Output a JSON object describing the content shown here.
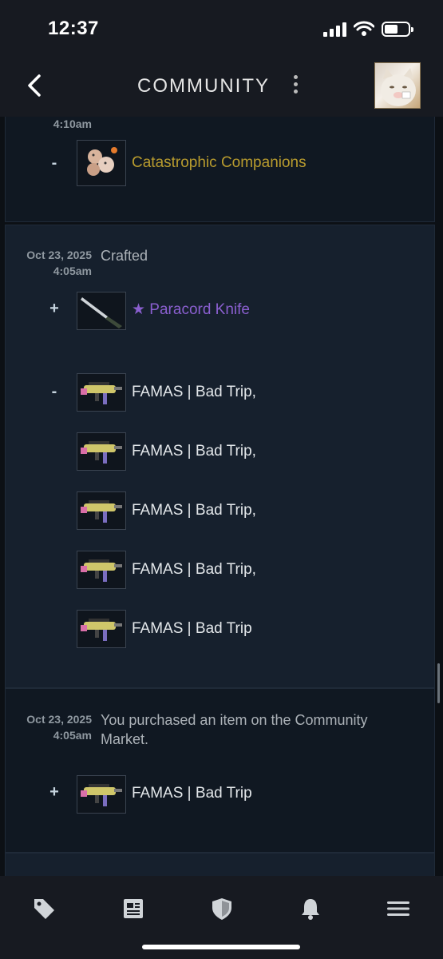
{
  "status_bar": {
    "time": "12:37"
  },
  "header": {
    "title": "COMMUNITY"
  },
  "entries": [
    {
      "date": "",
      "time": "4:10am",
      "description": "",
      "items": [
        {
          "sign": "-",
          "name": "Catastrophic Companions",
          "icon": "sticker-capsule-icon"
        }
      ]
    },
    {
      "date": "Oct 23, 2025",
      "time": "4:05am",
      "description": "Crafted",
      "items": [
        {
          "sign": "+",
          "name": "★ Paracord Knife",
          "icon": "knife-icon"
        },
        {
          "sign": "-",
          "name": "FAMAS | Bad Trip,",
          "icon": "famas-icon"
        },
        {
          "sign": "",
          "name": "FAMAS | Bad Trip,",
          "icon": "famas-icon"
        },
        {
          "sign": "",
          "name": "FAMAS | Bad Trip,",
          "icon": "famas-icon"
        },
        {
          "sign": "",
          "name": "FAMAS | Bad Trip,",
          "icon": "famas-icon"
        },
        {
          "sign": "",
          "name": "FAMAS | Bad Trip",
          "icon": "famas-icon"
        }
      ]
    },
    {
      "date": "Oct 23, 2025",
      "time": "4:05am",
      "description": "You purchased an item on the Community Market.",
      "items": [
        {
          "sign": "+",
          "name": "FAMAS | Bad Trip",
          "icon": "famas-icon"
        }
      ]
    }
  ],
  "bottom_nav": [
    {
      "label": "tag-icon"
    },
    {
      "label": "news-icon"
    },
    {
      "label": "shield-icon"
    },
    {
      "label": "bell-icon"
    },
    {
      "label": "menu-icon"
    }
  ],
  "colors": {
    "gold_item": "#b89b2e",
    "covert_item": "#8a5fcf",
    "background": "#0c1015"
  }
}
